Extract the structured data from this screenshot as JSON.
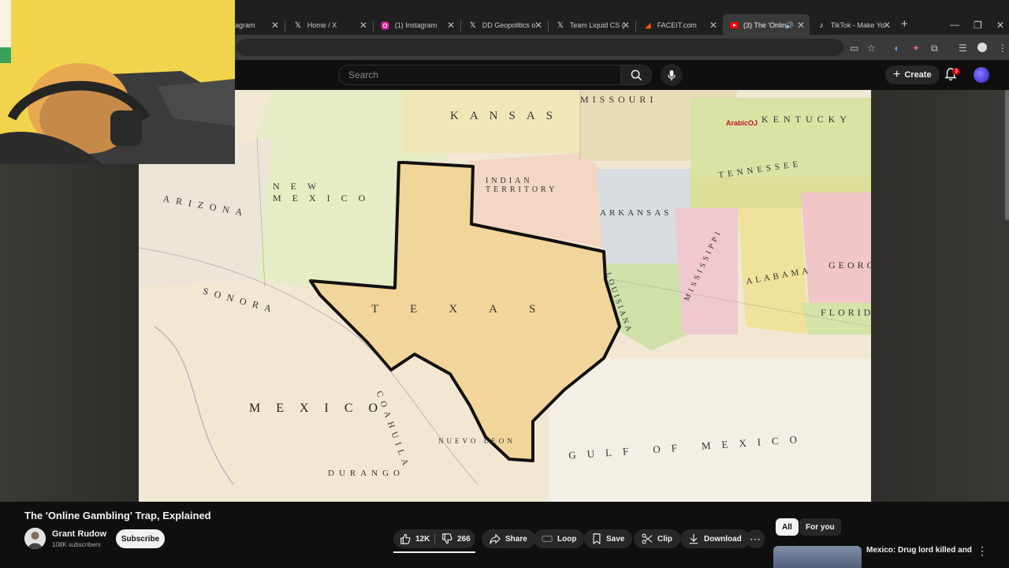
{
  "browser": {
    "tabs": [
      {
        "title": "agram",
        "icon": "instagram-icon",
        "active": false
      },
      {
        "title": "Home / X",
        "icon": "x-icon",
        "active": false
      },
      {
        "title": "(1) Instagram",
        "icon": "instagram-icon",
        "active": false
      },
      {
        "title": "DD Geopolitics o",
        "icon": "x-icon",
        "active": false
      },
      {
        "title": "Team Liquid CS (",
        "icon": "x-icon",
        "active": false
      },
      {
        "title": "FACEIT.com",
        "icon": "faceit-icon",
        "active": false
      },
      {
        "title": "(3) The 'Onlin",
        "icon": "youtube-icon",
        "active": true
      },
      {
        "title": "TikTok - Make Yo",
        "icon": "tiktok-icon",
        "active": false
      }
    ],
    "new_tab": "+"
  },
  "youtube": {
    "search_placeholder": "Search",
    "create_label": "Create",
    "notification_count": "3",
    "accent": "#ff0000"
  },
  "map": {
    "states": [
      "KANSAS",
      "MISSOURI",
      "KENTUCKY",
      "NEW MEXICO",
      "INDIAN TERRITORY",
      "ARKANSAS",
      "TENNESSEE",
      "ARIZONA",
      "TEXAS",
      "LOUISIANA",
      "MISSISSIPPI",
      "ALABAMA",
      "GEORGIA",
      "FLORIDA",
      "SONORA",
      "MEXICO",
      "COAHUILA",
      "DURANGO",
      "NUEVO LEON"
    ],
    "gulf_label": "GULF OF MEXICO",
    "overlay_text": "ArabicOJ"
  },
  "video": {
    "title": "The 'Online Gambling' Trap, Explained",
    "channel": "Grant Rudow",
    "subscribers": "108K subscribers",
    "subscribe_label": "Subscribe",
    "likes": "12K",
    "dislikes": "266",
    "share_label": "Share",
    "loop_label": "Loop",
    "save_label": "Save",
    "clip_label": "Clip",
    "download_label": "Download"
  },
  "sidebar": {
    "chips": [
      "All",
      "For you"
    ],
    "rec_title": "Mexico: Drug lord killed and"
  }
}
